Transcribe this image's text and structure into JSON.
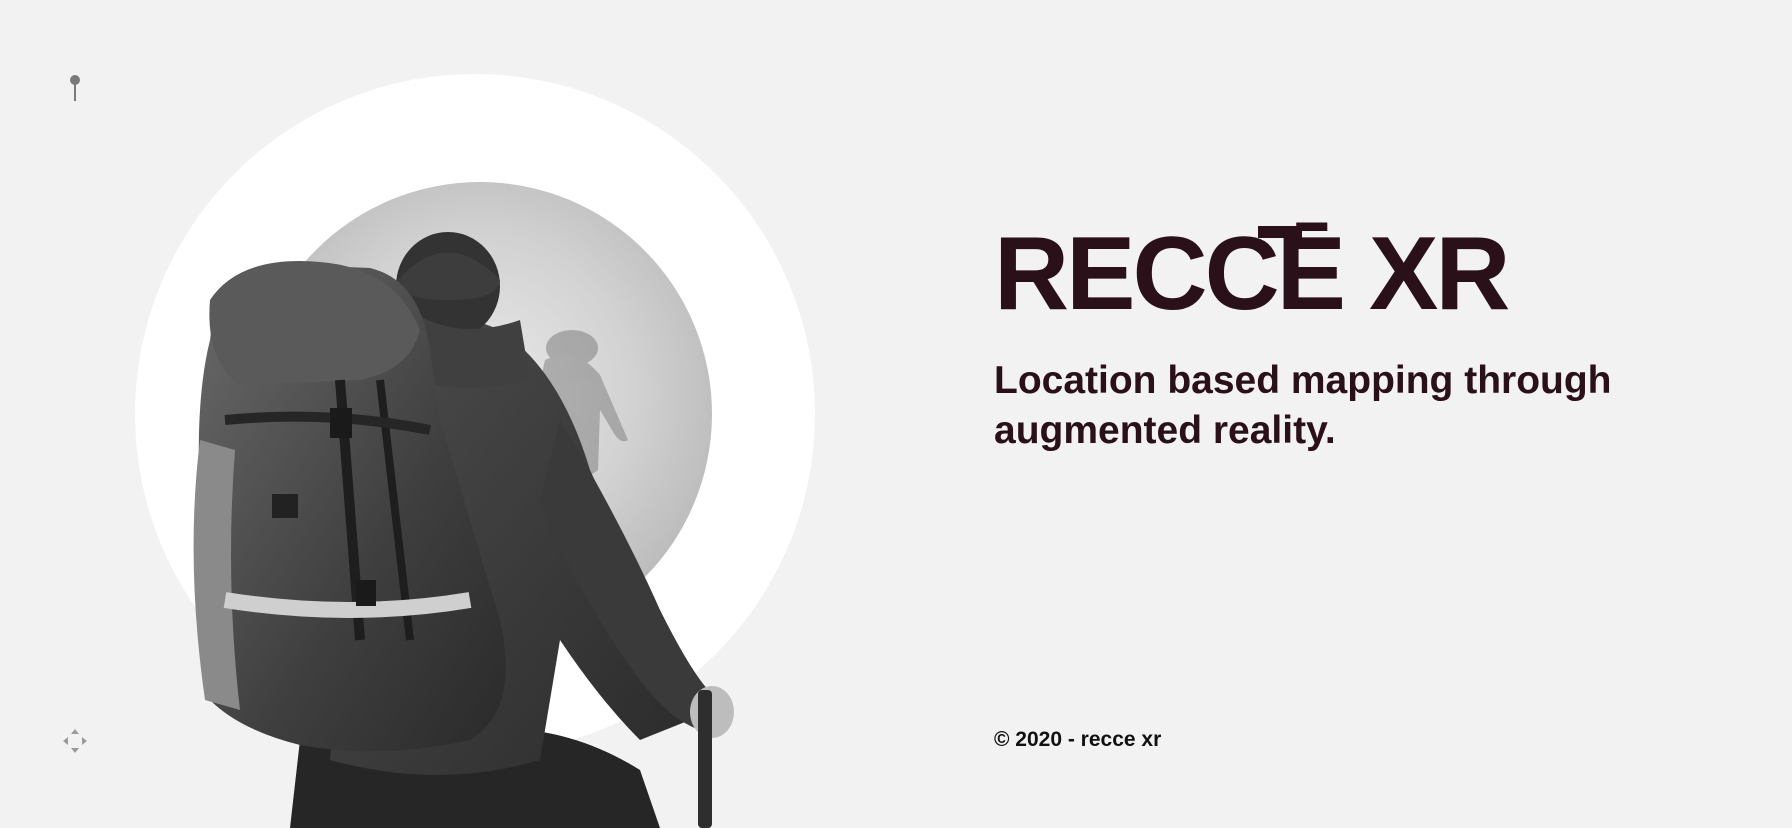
{
  "brand": {
    "logo_text": "RECCĒ XR",
    "color": "#2a1018"
  },
  "hero": {
    "tagline": "Location based mapping through augmented reality.",
    "image": "hiker-with-backpack-photo"
  },
  "footer": {
    "copyright": "© 2020 - recce xr"
  },
  "icons": {
    "top_left": "map-pin-icon",
    "bottom_left": "move-arrows-icon"
  },
  "colors": {
    "background": "#f2f2f2",
    "ring": "#ffffff",
    "text_dark": "#2a1018"
  }
}
